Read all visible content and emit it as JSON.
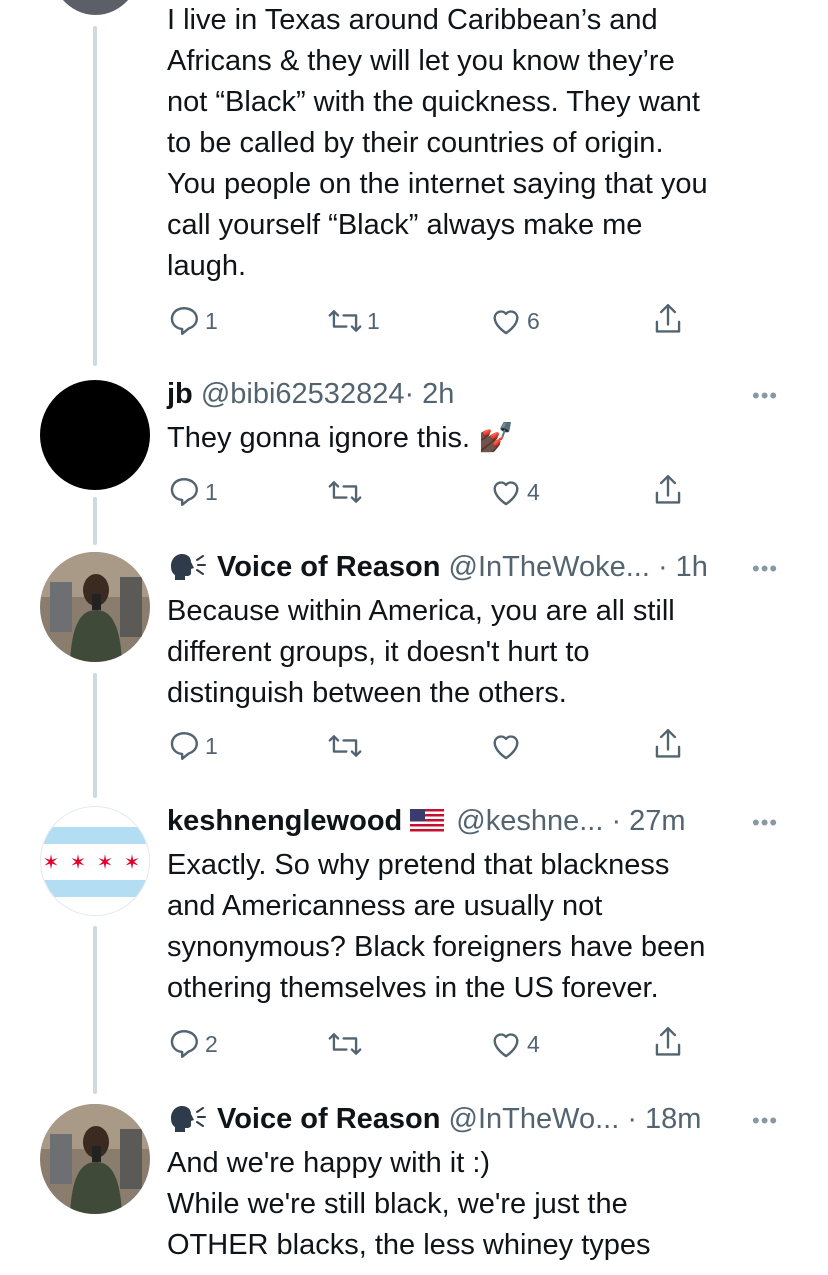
{
  "tweets": [
    {
      "text": "I live in Texas around Caribbean’s and\nAfricans & they will let you know they’re\nnot “Black” with the quickness. They want\nto be called by their countries of origin.\nYou people on the internet saying that you\ncall yourself “Black” always make me\nlaugh.",
      "replies": "1",
      "retweets": "1",
      "likes": "6"
    },
    {
      "name": "jb",
      "handle": "@bibi62532824",
      "time": "· 2h",
      "text": "They gonna ignore this. 💅🏿",
      "replies": "1",
      "retweets": "",
      "likes": "4"
    },
    {
      "name": "Voice of Reason",
      "handle": "@InTheWoke...",
      "time": " · 1h",
      "text": "Because within America, you are all still\ndifferent groups, it doesn't hurt to\ndistinguish between the others.",
      "replies": "1",
      "retweets": "",
      "likes": ""
    },
    {
      "name": "keshnenglewood",
      "handle": "@keshne...",
      "time": " · 27m",
      "text": "Exactly. So why pretend that blackness\nand Americanness are usually not\nsynonymous?  Black foreigners have been\nothering themselves in the US forever.",
      "replies": "2",
      "retweets": "",
      "likes": "4"
    },
    {
      "name": "Voice of Reason",
      "handle": "@InTheWo...",
      "time": " · 18m",
      "text": "And we're happy with it :)\nWhile we're still black, we're just the\nOTHER blacks, the less whiney types"
    }
  ],
  "more_label": "•••",
  "icons": {
    "reply": "reply-icon",
    "retweet": "retweet-icon",
    "like": "heart-icon",
    "share": "share-icon",
    "speaker": "speaking-head-icon",
    "flag": "us-flag-icon"
  },
  "colors": {
    "icon_gray": "#536471",
    "thread_line": "#cfd9de",
    "text": "#0f1419"
  }
}
